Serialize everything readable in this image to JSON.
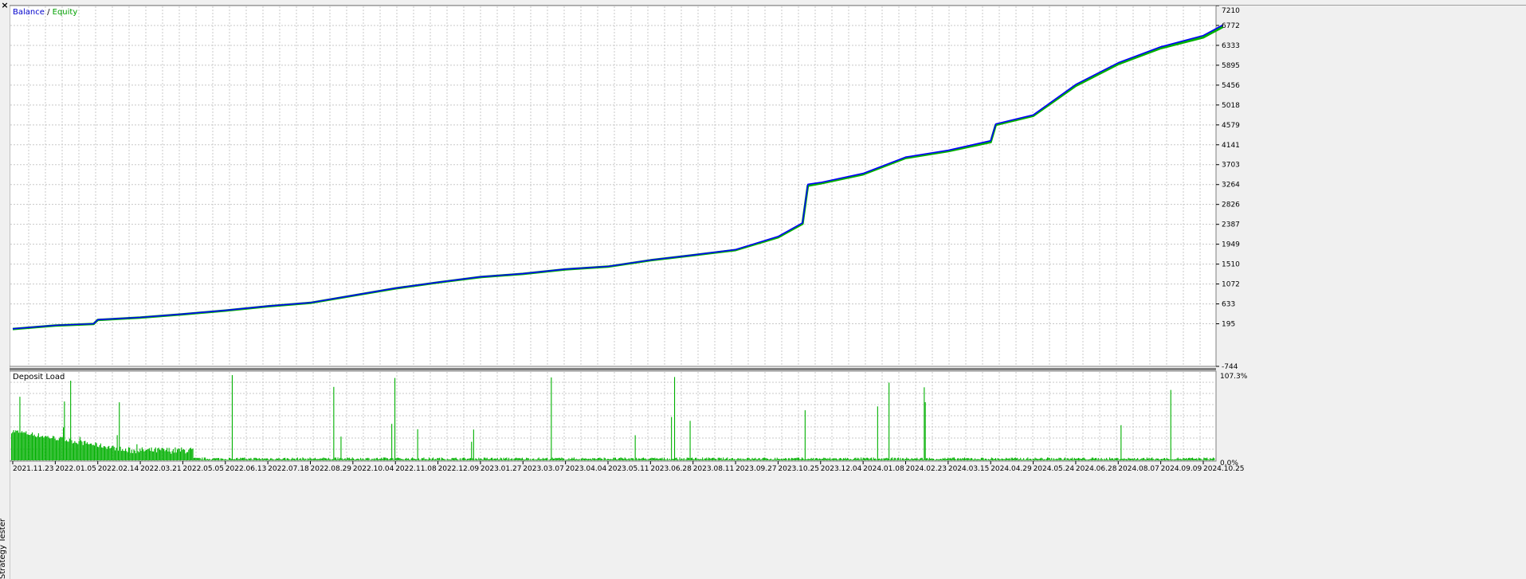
{
  "window": {
    "close_glyph": "×",
    "side_tab_label": "Strategy Tester"
  },
  "colors": {
    "balance": "#0000ff",
    "equity": "#00b000",
    "grid": "#c8c8c8",
    "plot_bg": "#ffffff",
    "axis_text": "#000000"
  },
  "chart_data": [
    {
      "type": "line",
      "legend": [
        "Balance",
        "Equity"
      ],
      "legend_separator": "/",
      "legend_position": "top-left",
      "grid": true,
      "ylim": [
        -744,
        7210
      ],
      "y_ticks": [
        -744,
        195,
        633,
        1072,
        1510,
        1949,
        2387,
        2826,
        3264,
        3703,
        4141,
        4579,
        5018,
        5456,
        5895,
        6333,
        6772,
        7210
      ],
      "x_ticks": [
        "2021.11.23",
        "2022.01.05",
        "2022.02.14",
        "2022.03.21",
        "2022.05.05",
        "2022.06.13",
        "2022.07.18",
        "2022.08.29",
        "2022.10.04",
        "2022.11.08",
        "2022.12.09",
        "2023.01.27",
        "2023.03.07",
        "2023.04.04",
        "2023.05.11",
        "2023.06.28",
        "2023.08.11",
        "2023.09.27",
        "2023.10.25",
        "2023.12.04",
        "2024.01.08",
        "2024.02.23",
        "2024.03.15",
        "2024.04.29",
        "2024.05.24",
        "2024.06.28",
        "2024.08.07",
        "2024.09.09",
        "2024.10.25"
      ],
      "x": [
        "2021.11.23",
        "2022.01.05",
        "2022.02.10",
        "2022.02.14",
        "2022.03.21",
        "2022.05.05",
        "2022.06.13",
        "2022.07.18",
        "2022.08.29",
        "2022.10.04",
        "2022.11.08",
        "2022.12.09",
        "2023.01.27",
        "2023.03.07",
        "2023.04.04",
        "2023.05.11",
        "2023.06.28",
        "2023.08.11",
        "2023.09.27",
        "2023.10.25",
        "2023.11.17",
        "2023.11.22",
        "2023.12.04",
        "2024.01.08",
        "2024.02.23",
        "2024.03.15",
        "2024.04.29",
        "2024.05.02",
        "2024.05.24",
        "2024.06.28",
        "2024.08.07",
        "2024.09.09",
        "2024.10.25",
        "2024.11.15"
      ],
      "series": [
        {
          "name": "Balance",
          "values": [
            85,
            160,
            195,
            285,
            335,
            410,
            490,
            585,
            660,
            820,
            980,
            1110,
            1230,
            1300,
            1400,
            1460,
            1600,
            1710,
            1830,
            2120,
            2420,
            3270,
            3310,
            3510,
            3870,
            4020,
            4230,
            4600,
            4800,
            5470,
            5950,
            6300,
            6550,
            6780
          ]
        },
        {
          "name": "Equity",
          "values": [
            80,
            155,
            190,
            280,
            330,
            405,
            485,
            580,
            655,
            815,
            975,
            1105,
            1225,
            1295,
            1395,
            1455,
            1595,
            1705,
            1820,
            2100,
            2400,
            3240,
            3290,
            3490,
            3850,
            4000,
            4200,
            4580,
            4780,
            5440,
            5920,
            6270,
            6510,
            6740
          ]
        }
      ]
    },
    {
      "type": "bar",
      "title": "Deposit Load",
      "y_ticks": [
        "107.3%",
        "0.0%"
      ],
      "ylim": [
        0,
        107.3
      ]
    }
  ]
}
